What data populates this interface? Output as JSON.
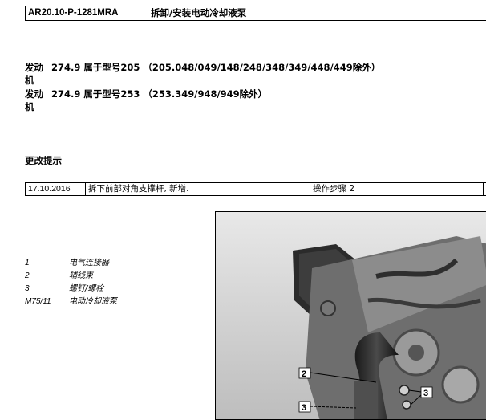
{
  "header": {
    "code": "AR20.10-P-1281MRA",
    "title": "拆卸/安装电动冷却液泵"
  },
  "engines": [
    {
      "label": "发动机",
      "text": "274.9 属于型号205 （205.048/049/148/248/348/349/448/449除外）"
    },
    {
      "label": "发动机",
      "text": "274.9 属于型号253 （253.349/948/949除外）"
    }
  ],
  "changes": {
    "heading": "更改提示",
    "rows": [
      {
        "date": "17.10.2016",
        "description": "拆下前部对角支撑杆, 新增.",
        "reference": "操作步骤 2"
      }
    ]
  },
  "legend": [
    {
      "key": "1",
      "value": "电气连接器"
    },
    {
      "key": "2",
      "value": "辅线束"
    },
    {
      "key": "3",
      "value": "螺钉/螺栓"
    },
    {
      "key": "M75/11",
      "value": "电动冷却液泵"
    }
  ],
  "figure": {
    "callouts": [
      "2",
      "3",
      "3"
    ]
  }
}
